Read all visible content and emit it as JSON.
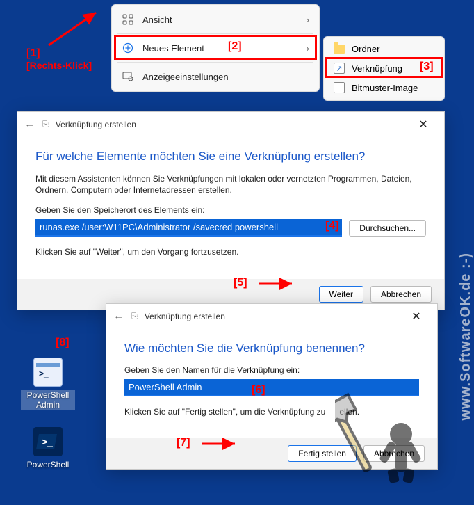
{
  "annotations": {
    "a1": {
      "label": "[1]",
      "sub": "[Rechts-Klick]"
    },
    "a2": "[2]",
    "a3": "[3]",
    "a4": "[4]",
    "a5": "[5]",
    "a6": "[6]",
    "a7": "[7]",
    "a8": "[8]"
  },
  "context_menu": {
    "view": "Ansicht",
    "new_item": "Neues Element",
    "display_settings": "Anzeigeeinstellungen"
  },
  "submenu": {
    "folder": "Ordner",
    "shortcut": "Verknüpfung",
    "bitmap": "Bitmuster-Image"
  },
  "dialog1": {
    "title": "Verknüpfung erstellen",
    "heading": "Für welche Elemente möchten Sie eine Verknüpfung erstellen?",
    "desc": "Mit diesem Assistenten können Sie Verknüpfungen mit lokalen oder vernetzten Programmen, Dateien, Ordnern, Computern oder Internetadressen erstellen.",
    "label": "Geben Sie den Speicherort des Elements ein:",
    "input": "runas.exe /user:W11PC\\Administrator /savecred powershell",
    "browse": "Durchsuchen...",
    "hint": "Klicken Sie auf \"Weiter\", um den Vorgang fortzusetzen.",
    "next": "Weiter",
    "cancel": "Abbrechen"
  },
  "dialog2": {
    "title": "Verknüpfung erstellen",
    "heading": "Wie möchten Sie die Verknüpfung benennen?",
    "label": "Geben Sie den Namen für die Verknüpfung ein:",
    "input": "PowerShell Admin",
    "hint_a": "Klicken Sie auf \"Fertig stellen\", um die Verknüpfung zu",
    "hint_b": "ellen.",
    "finish": "Fertig stellen",
    "cancel": "Abbrechen"
  },
  "desktop": {
    "icon1": "PowerShell Admin",
    "icon2": "PowerShell"
  },
  "watermark": "www.SoftwareOK.de :-)"
}
